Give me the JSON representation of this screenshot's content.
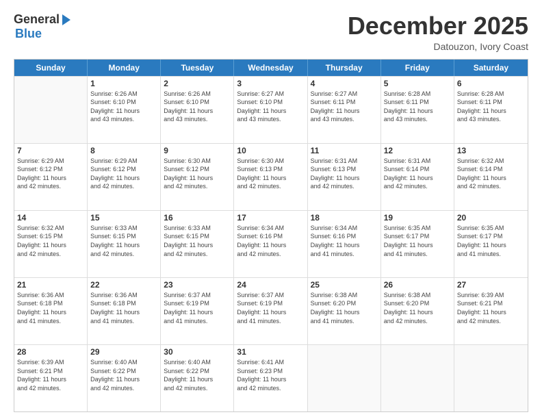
{
  "logo": {
    "general": "General",
    "blue": "Blue"
  },
  "title": "December 2025",
  "subtitle": "Datouzon, Ivory Coast",
  "header_days": [
    "Sunday",
    "Monday",
    "Tuesday",
    "Wednesday",
    "Thursday",
    "Friday",
    "Saturday"
  ],
  "rows": [
    [
      {
        "day": "",
        "info": "",
        "empty": true
      },
      {
        "day": "1",
        "info": "Sunrise: 6:26 AM\nSunset: 6:10 PM\nDaylight: 11 hours\nand 43 minutes."
      },
      {
        "day": "2",
        "info": "Sunrise: 6:26 AM\nSunset: 6:10 PM\nDaylight: 11 hours\nand 43 minutes."
      },
      {
        "day": "3",
        "info": "Sunrise: 6:27 AM\nSunset: 6:10 PM\nDaylight: 11 hours\nand 43 minutes."
      },
      {
        "day": "4",
        "info": "Sunrise: 6:27 AM\nSunset: 6:11 PM\nDaylight: 11 hours\nand 43 minutes."
      },
      {
        "day": "5",
        "info": "Sunrise: 6:28 AM\nSunset: 6:11 PM\nDaylight: 11 hours\nand 43 minutes."
      },
      {
        "day": "6",
        "info": "Sunrise: 6:28 AM\nSunset: 6:11 PM\nDaylight: 11 hours\nand 43 minutes."
      }
    ],
    [
      {
        "day": "7",
        "info": "Sunrise: 6:29 AM\nSunset: 6:12 PM\nDaylight: 11 hours\nand 42 minutes."
      },
      {
        "day": "8",
        "info": "Sunrise: 6:29 AM\nSunset: 6:12 PM\nDaylight: 11 hours\nand 42 minutes."
      },
      {
        "day": "9",
        "info": "Sunrise: 6:30 AM\nSunset: 6:12 PM\nDaylight: 11 hours\nand 42 minutes."
      },
      {
        "day": "10",
        "info": "Sunrise: 6:30 AM\nSunset: 6:13 PM\nDaylight: 11 hours\nand 42 minutes."
      },
      {
        "day": "11",
        "info": "Sunrise: 6:31 AM\nSunset: 6:13 PM\nDaylight: 11 hours\nand 42 minutes."
      },
      {
        "day": "12",
        "info": "Sunrise: 6:31 AM\nSunset: 6:14 PM\nDaylight: 11 hours\nand 42 minutes."
      },
      {
        "day": "13",
        "info": "Sunrise: 6:32 AM\nSunset: 6:14 PM\nDaylight: 11 hours\nand 42 minutes."
      }
    ],
    [
      {
        "day": "14",
        "info": "Sunrise: 6:32 AM\nSunset: 6:15 PM\nDaylight: 11 hours\nand 42 minutes."
      },
      {
        "day": "15",
        "info": "Sunrise: 6:33 AM\nSunset: 6:15 PM\nDaylight: 11 hours\nand 42 minutes."
      },
      {
        "day": "16",
        "info": "Sunrise: 6:33 AM\nSunset: 6:15 PM\nDaylight: 11 hours\nand 42 minutes."
      },
      {
        "day": "17",
        "info": "Sunrise: 6:34 AM\nSunset: 6:16 PM\nDaylight: 11 hours\nand 42 minutes."
      },
      {
        "day": "18",
        "info": "Sunrise: 6:34 AM\nSunset: 6:16 PM\nDaylight: 11 hours\nand 41 minutes."
      },
      {
        "day": "19",
        "info": "Sunrise: 6:35 AM\nSunset: 6:17 PM\nDaylight: 11 hours\nand 41 minutes."
      },
      {
        "day": "20",
        "info": "Sunrise: 6:35 AM\nSunset: 6:17 PM\nDaylight: 11 hours\nand 41 minutes."
      }
    ],
    [
      {
        "day": "21",
        "info": "Sunrise: 6:36 AM\nSunset: 6:18 PM\nDaylight: 11 hours\nand 41 minutes."
      },
      {
        "day": "22",
        "info": "Sunrise: 6:36 AM\nSunset: 6:18 PM\nDaylight: 11 hours\nand 41 minutes."
      },
      {
        "day": "23",
        "info": "Sunrise: 6:37 AM\nSunset: 6:19 PM\nDaylight: 11 hours\nand 41 minutes."
      },
      {
        "day": "24",
        "info": "Sunrise: 6:37 AM\nSunset: 6:19 PM\nDaylight: 11 hours\nand 41 minutes."
      },
      {
        "day": "25",
        "info": "Sunrise: 6:38 AM\nSunset: 6:20 PM\nDaylight: 11 hours\nand 41 minutes."
      },
      {
        "day": "26",
        "info": "Sunrise: 6:38 AM\nSunset: 6:20 PM\nDaylight: 11 hours\nand 42 minutes."
      },
      {
        "day": "27",
        "info": "Sunrise: 6:39 AM\nSunset: 6:21 PM\nDaylight: 11 hours\nand 42 minutes."
      }
    ],
    [
      {
        "day": "28",
        "info": "Sunrise: 6:39 AM\nSunset: 6:21 PM\nDaylight: 11 hours\nand 42 minutes."
      },
      {
        "day": "29",
        "info": "Sunrise: 6:40 AM\nSunset: 6:22 PM\nDaylight: 11 hours\nand 42 minutes."
      },
      {
        "day": "30",
        "info": "Sunrise: 6:40 AM\nSunset: 6:22 PM\nDaylight: 11 hours\nand 42 minutes."
      },
      {
        "day": "31",
        "info": "Sunrise: 6:41 AM\nSunset: 6:23 PM\nDaylight: 11 hours\nand 42 minutes."
      },
      {
        "day": "",
        "info": "",
        "empty": true
      },
      {
        "day": "",
        "info": "",
        "empty": true
      },
      {
        "day": "",
        "info": "",
        "empty": true
      }
    ]
  ]
}
